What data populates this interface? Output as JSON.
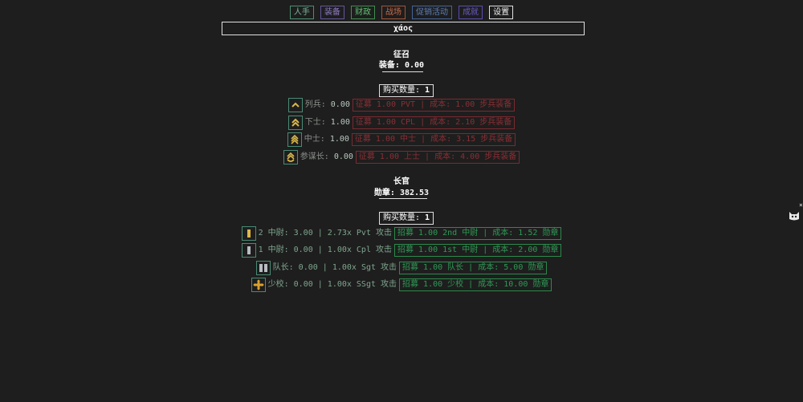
{
  "tabs": [
    "人手",
    "装备",
    "财政",
    "战场",
    "促销活动",
    "成就",
    "设置"
  ],
  "title": "χάος",
  "recruit": {
    "title": "征召",
    "resource_label": "装备: ",
    "resource_value": "0.00",
    "qty_label": "购买数量: ",
    "qty_value": "1",
    "rows": [
      {
        "icon": "private-rank-icon",
        "name": "列兵",
        "value": "0.00",
        "button": "征募 1.00 PVT | 成本: 1.00 步兵装备"
      },
      {
        "icon": "corporal-rank-icon",
        "name": "下士",
        "value": "1.00",
        "button": "征募 1.00 CPL | 成本: 2.10 步兵装备"
      },
      {
        "icon": "sergeant-rank-icon",
        "name": "中士",
        "value": "1.00",
        "button": "征募 1.00 中士 | 成本: 3.15 步兵装备"
      },
      {
        "icon": "staff-sergeant-rank-icon",
        "name": "参谋长",
        "value": "0.00",
        "button": "征募 1.00 上士 | 成本: 4.00 步兵装备"
      }
    ]
  },
  "officers": {
    "title": "长官",
    "resource_label": "勋章: ",
    "resource_value": "382.53",
    "qty_label": "购买数量: ",
    "qty_value": "1",
    "rows": [
      {
        "icon": "second-lieutenant-rank-icon",
        "text": "2 中尉: 3.00 | 2.73x Pvt 攻击",
        "button": "招募 1.00 2nd 中尉 | 成本: 1.52 勋章"
      },
      {
        "icon": "first-lieutenant-rank-icon",
        "text": "1 中尉: 0.00 | 1.00x Cpl 攻击",
        "button": "招募 1.00 1st 中尉 | 成本: 2.00 勋章"
      },
      {
        "icon": "captain-rank-icon",
        "text": "队长: 0.00 | 1.00x Sgt 攻击",
        "button": "招募 1.00 队长 | 成本: 5.00 勋章"
      },
      {
        "icon": "major-rank-icon",
        "text": "少校: 0.00 | 1.00x SSgt 攻击",
        "button": "招募 1.00 少校 | 成本: 10.00 勋章"
      }
    ]
  },
  "side_widget": {
    "icon": "cat-face-icon",
    "close": "×"
  }
}
